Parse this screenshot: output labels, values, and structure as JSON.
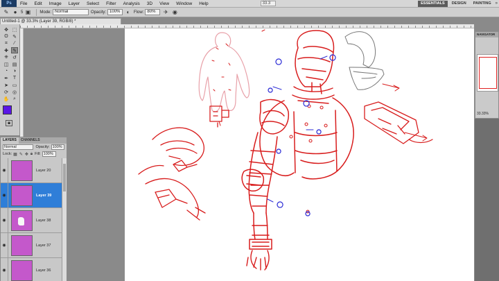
{
  "menu": {
    "logo": "Ps",
    "items": [
      "File",
      "Edit",
      "Image",
      "Layer",
      "Select",
      "Filter",
      "Analysis",
      "3D",
      "View",
      "Window",
      "Help"
    ],
    "zoom": "33.3",
    "workspaces": [
      "ESSENTIALS",
      "DESIGN",
      "PAINTING"
    ],
    "more": "»"
  },
  "options": {
    "mode_label": "Mode:",
    "mode_value": "Normal",
    "opacity_label": "Opacity:",
    "opacity_value": "100%",
    "flow_label": "Flow:",
    "flow_value": "80%",
    "brush_size": "5"
  },
  "document": {
    "tab_title": "Untitled-1 @ 33.3% (Layer 39, RGB/8) *"
  },
  "tools": {
    "icons": [
      "move-icon",
      "marquee-icon",
      "lasso-icon",
      "quick-select-icon",
      "crop-icon",
      "eyedropper-icon",
      "heal-icon",
      "brush-icon",
      "stamp-icon",
      "history-brush-icon",
      "eraser-icon",
      "gradient-icon",
      "blur-icon",
      "dodge-icon",
      "pen-icon",
      "type-icon",
      "path-select-icon",
      "shape-icon",
      "3d-rotate-icon",
      "3d-orbit-icon",
      "hand-icon",
      "zoom-icon"
    ],
    "glyphs": [
      "✥",
      "⬚",
      "ʘ",
      "✎",
      "⌗",
      "⁄",
      "✚",
      "✎",
      "⎈",
      "↺",
      "◫",
      "▤",
      "◔",
      "◑",
      "✒",
      "T",
      "➤",
      "▭",
      "⟳",
      "◎",
      "✋",
      "⌕"
    ],
    "active_index": 7,
    "foreground_color": "#5a16e6",
    "background_color": "#ffffff"
  },
  "layers_panel": {
    "tabs": [
      "LAYERS",
      "CHANNELS"
    ],
    "blend_mode": "Normal",
    "opacity_label": "Opacity:",
    "opacity_value": "100%",
    "lock_label": "Lock:",
    "fill_label": "Fill:",
    "fill_value": "100%",
    "layers": [
      {
        "name": "Layer 20",
        "selected": false,
        "has_mark": false
      },
      {
        "name": "Layer 39",
        "selected": true,
        "has_mark": false
      },
      {
        "name": "Layer 38",
        "selected": false,
        "has_mark": true
      },
      {
        "name": "Layer 37",
        "selected": false,
        "has_mark": false
      },
      {
        "name": "Layer 36",
        "selected": false,
        "has_mark": false
      }
    ]
  },
  "navigator": {
    "title": "NAVIGATOR",
    "zoom": "33.33%"
  },
  "colors": {
    "sketch_red": "#d81c1c",
    "sketch_pink": "#e8a0a8",
    "annotation_blue": "#2d2dd6",
    "selection_blue": "#2f7ed8",
    "layer_thumb": "#c458cb"
  }
}
